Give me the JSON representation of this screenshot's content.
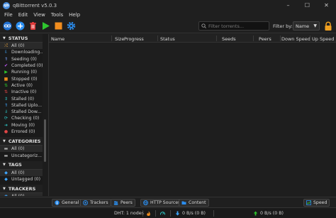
{
  "window": {
    "title": "qBittorrent v5.0.3",
    "app_icon_text": "qb",
    "controls": [
      "–",
      "☐",
      "✕"
    ]
  },
  "menu": [
    "File",
    "Edit",
    "View",
    "Tools",
    "Help"
  ],
  "toolbar": {
    "search_placeholder": "Filter torrents...",
    "filter_label": "Filter by:",
    "filter_value": "Name"
  },
  "sidebar": {
    "status_header": "STATUS",
    "status_items": [
      {
        "label": "All (0)",
        "icon": "shuffle-icon",
        "color": "#e8a33d"
      },
      {
        "label": "Downloading...",
        "icon": "download-arrow-icon",
        "color": "#3ea7ff"
      },
      {
        "label": "Seeding (0)",
        "icon": "upload-chevron-icon",
        "color": "#7aa7ff"
      },
      {
        "label": "Completed (0)",
        "icon": "check-icon",
        "color": "#c45cff"
      },
      {
        "label": "Running (0)",
        "icon": "play-icon",
        "color": "#2ec52e"
      },
      {
        "label": "Stopped (0)",
        "icon": "stop-icon",
        "color": "#e8891e"
      },
      {
        "label": "Active (0)",
        "icon": "active-arrows-icon",
        "color": "#2ec52e"
      },
      {
        "label": "Inactive (0)",
        "icon": "inactive-arrows-icon",
        "color": "#e24646"
      },
      {
        "label": "Stalled (0)",
        "icon": "stalled-icon",
        "color": "#2ec5c5"
      },
      {
        "label": "Stalled Uplo...",
        "icon": "stalled-upload-icon",
        "color": "#3ea7ff"
      },
      {
        "label": "Stalled Dow...",
        "icon": "stalled-download-icon",
        "color": "#2ec5c5"
      },
      {
        "label": "Checking (0)",
        "icon": "checking-icon",
        "color": "#2ec5c5"
      },
      {
        "label": "Moving (0)",
        "icon": "moving-icon",
        "color": "#2ec5c5"
      },
      {
        "label": "Errored (0)",
        "icon": "error-icon",
        "color": "#e24646"
      }
    ],
    "categories_header": "CATEGORIES",
    "categories_items": [
      {
        "label": "All (0)",
        "icon": "folder-icon",
        "color": "#aaaaaa"
      },
      {
        "label": "Uncategoriz...",
        "icon": "folder-icon",
        "color": "#aaaaaa"
      }
    ],
    "tags_header": "TAGS",
    "tags_items": [
      {
        "label": "All (0)",
        "icon": "tag-icon",
        "color": "#3ea7ff"
      },
      {
        "label": "Untagged (0)",
        "icon": "tag-icon",
        "color": "#3ea7ff"
      }
    ],
    "trackers_header": "TRACKERS",
    "trackers_items": [
      {
        "label": "All (0)",
        "icon": "tracker-icon",
        "color": "#3ea7ff"
      }
    ]
  },
  "list": {
    "columns": [
      "Name",
      "Size",
      "Progress",
      "Status",
      "Seeds",
      "Peers",
      "Down Speed",
      "Up Speed"
    ]
  },
  "tabs": [
    "General",
    "Trackers",
    "Peers",
    "HTTP Sources",
    "Content"
  ],
  "speed_button": "Speed",
  "status": {
    "dht": "DHT: 1 nodes",
    "down": "0 B/s (0 B)",
    "up": "0 B/s (0 B)"
  },
  "colors": {
    "accent_blue": "#2b8ef0",
    "red": "#e03a3a",
    "green": "#2ec52e",
    "orange": "#f08c1e"
  }
}
